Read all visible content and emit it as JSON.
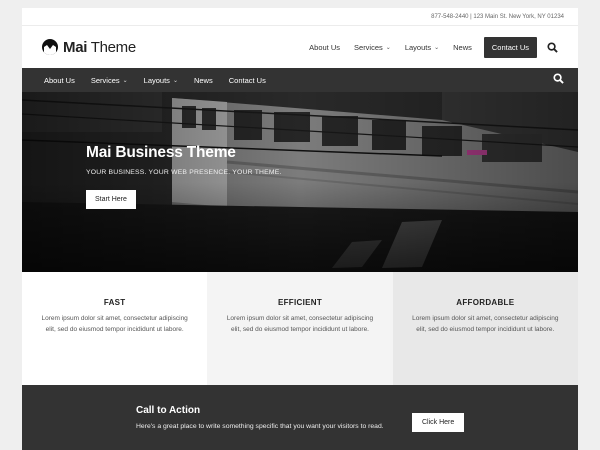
{
  "topbar": {
    "contact_info": "877-548-2440 | 123 Main St. New York, NY 01234"
  },
  "logo": {
    "name_bold": "Mai",
    "name_light": "Theme"
  },
  "header_nav": {
    "items": [
      {
        "label": "About Us",
        "has_dropdown": false
      },
      {
        "label": "Services",
        "has_dropdown": true
      },
      {
        "label": "Layouts",
        "has_dropdown": true
      },
      {
        "label": "News",
        "has_dropdown": false
      }
    ],
    "contact_button": "Contact Us",
    "search_icon": "search-icon"
  },
  "dark_nav": {
    "items": [
      {
        "label": "About Us",
        "has_dropdown": false
      },
      {
        "label": "Services",
        "has_dropdown": true
      },
      {
        "label": "Layouts",
        "has_dropdown": true
      },
      {
        "label": "News",
        "has_dropdown": false
      },
      {
        "label": "Contact Us",
        "has_dropdown": false
      }
    ],
    "search_icon": "search-icon"
  },
  "hero": {
    "title": "Mai Business Theme",
    "subtitle": "YOUR BUSINESS. YOUR WEB PRESENCE. YOUR THEME.",
    "button": "Start Here"
  },
  "features": [
    {
      "title": "FAST",
      "text": "Lorem ipsum dolor sit amet, consectetur adipiscing elit, sed do eiusmod tempor incididunt ut labore."
    },
    {
      "title": "EFFICIENT",
      "text": "Lorem ipsum dolor sit amet, consectetur adipiscing elit, sed do eiusmod tempor incididunt ut labore."
    },
    {
      "title": "AFFORDABLE",
      "text": "Lorem ipsum dolor sit amet, consectetur adipiscing elit, sed do eiusmod tempor incididunt ut labore."
    }
  ],
  "cta": {
    "title": "Call to Action",
    "text": "Here's a great place to write something specific that you want your visitors to read.",
    "button": "Click Here"
  },
  "colors": {
    "dark": "#333333",
    "page_bg": "#efefef",
    "feature_mid": "#f4f4f4",
    "feature_right": "#e8e8e8"
  }
}
